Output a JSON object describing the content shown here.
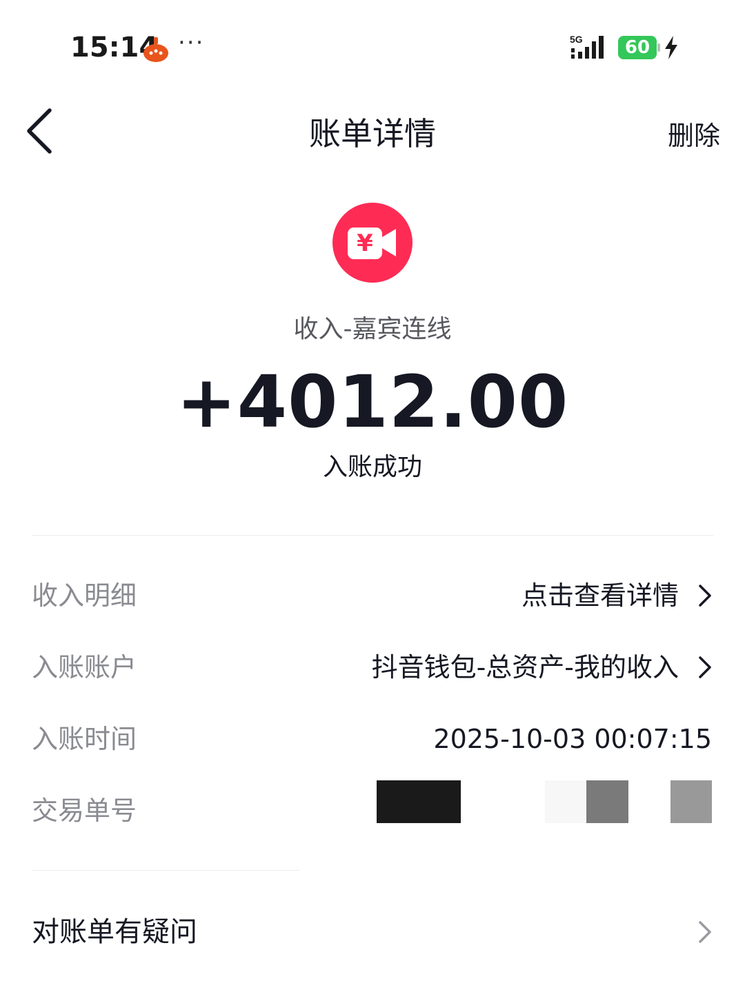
{
  "status_bar": {
    "time": "15:14",
    "more": "···",
    "network": "5G",
    "battery_level": "60",
    "icons": [
      "app-notification-icon",
      "signal-icon",
      "battery-icon",
      "charging-icon"
    ]
  },
  "nav": {
    "title": "账单详情",
    "delete_label": "删除",
    "back_icon": "chevron-left-icon"
  },
  "summary": {
    "icon": "video-yuan-icon",
    "income_type": "收入-嘉宾连线",
    "amount": "+4012.00",
    "status": "入账成功"
  },
  "details": {
    "income_detail": {
      "label": "收入明细",
      "value": "点击查看详情"
    },
    "account": {
      "label": "入账账户",
      "value": "抖音钱包-总资产-我的收入"
    },
    "time": {
      "label": "入账时间",
      "value": "2025-10-03 00:07:15"
    },
    "order_no": {
      "label": "交易单号",
      "value": ""
    }
  },
  "help": {
    "label": "对账单有疑问"
  },
  "colors": {
    "accent_red": "#fe2c55",
    "battery_green": "#34c759",
    "text_primary": "#161823",
    "text_secondary": "#8a8b91"
  }
}
